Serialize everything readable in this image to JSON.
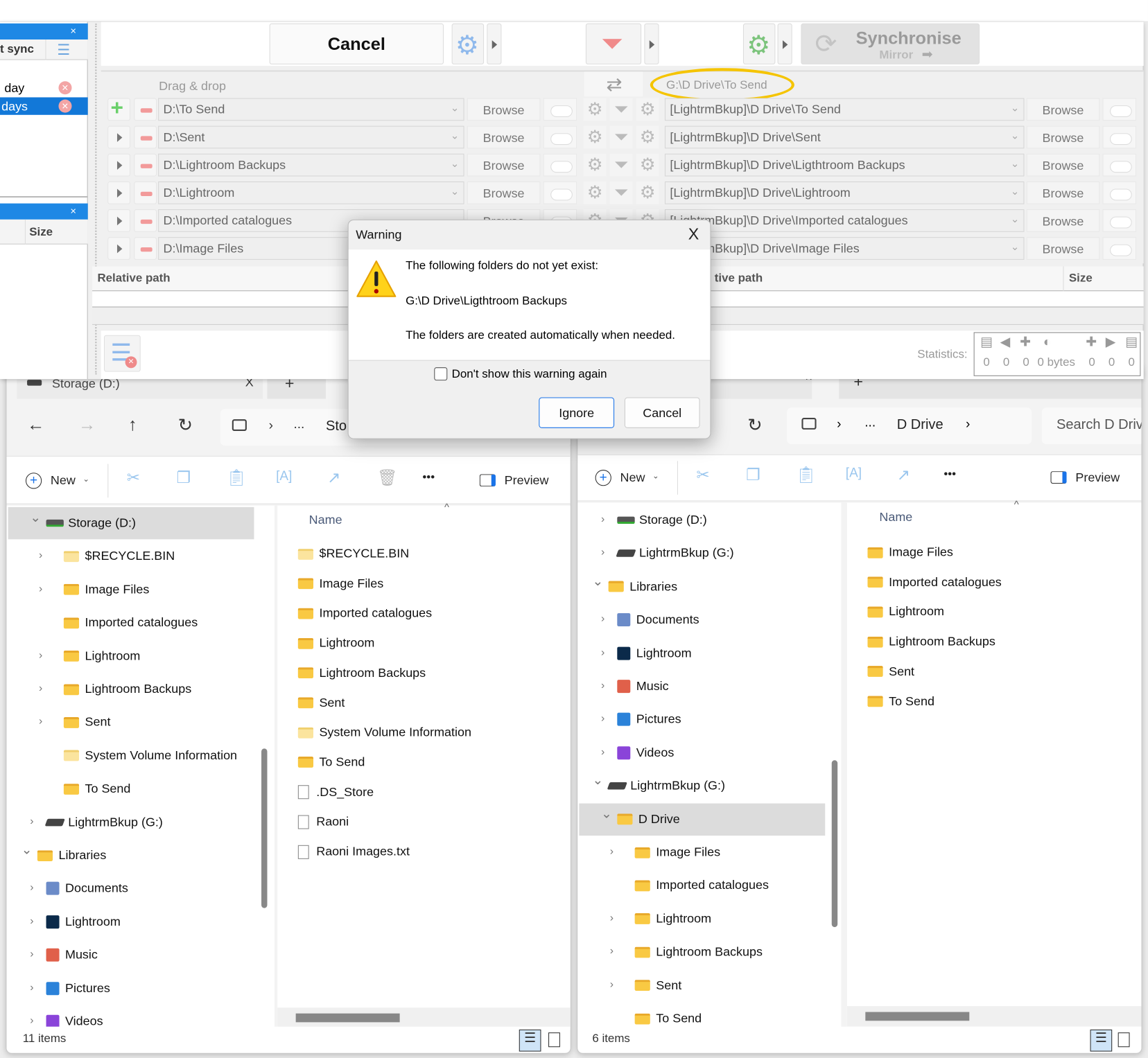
{
  "ffs": {
    "left_panel": {
      "close": "×",
      "col_header": "t sync",
      "items": [
        "day",
        "days"
      ],
      "panel2_close": "×",
      "size_header": "Size"
    },
    "toolbar": {
      "cancel": "Cancel",
      "sync_title": "Synchronise",
      "sync_mode": "Mirror"
    },
    "header": {
      "left_hint": "Drag & drop",
      "right_path": "G:\\D Drive\\To Send"
    },
    "browse_label": "Browse",
    "pairs": [
      {
        "left": "D:\\To Send",
        "right": "[LightrmBkup]\\D Drive\\To Send"
      },
      {
        "left": "D:\\Sent",
        "right": "[LightrmBkup]\\D Drive\\Sent"
      },
      {
        "left": "D:\\Lightroom Backups",
        "right": "[LightrmBkup]\\D Drive\\Ligthtroom Backups"
      },
      {
        "left": "D:\\Lightroom",
        "right": "[LightrmBkup]\\D Drive\\Lightroom"
      },
      {
        "left": "D:\\Imported catalogues",
        "right": "[LightrmBkup]\\D Drive\\Imported catalogues"
      },
      {
        "left": "D:\\Image Files",
        "right": "[LightrmBkup]\\D Drive\\Image Files"
      }
    ],
    "grid": {
      "left_col": "Relative path",
      "right_col": "tive path",
      "size_col": "Size"
    },
    "statistics": {
      "label": "Statistics:",
      "values": [
        "0",
        "0",
        "0",
        "0 bytes",
        "0",
        "0",
        "0"
      ]
    },
    "highlight_color": "#f5c400",
    "accent": "#1e88e5"
  },
  "dialog": {
    "title": "Warning",
    "close": "X",
    "line1": "The following folders do not yet exist:",
    "folder": "G:\\D Drive\\Ligthtroom Backups",
    "line2": "The folders are created automatically when needed.",
    "checkbox": "Don't show this warning again",
    "checked": false,
    "ignore": "Ignore",
    "cancel": "Cancel"
  },
  "explorer_left": {
    "tab": "Storage (D:)",
    "tab_close": "X",
    "new_tab": "+",
    "breadcrumb": [
      "...",
      "Sto"
    ],
    "new": "New",
    "preview": "Preview",
    "more": "•••",
    "tree": [
      {
        "label": "Storage (D:)",
        "icon": "drive",
        "level": 0,
        "chev": "down",
        "selected": true
      },
      {
        "label": "$RECYCLE.BIN",
        "icon": "folder-pale",
        "level": 1,
        "chev": "right"
      },
      {
        "label": "Image Files",
        "icon": "folder",
        "level": 1,
        "chev": "right"
      },
      {
        "label": "Imported catalogues",
        "icon": "folder",
        "level": 1,
        "chev": ""
      },
      {
        "label": "Lightroom",
        "icon": "folder",
        "level": 1,
        "chev": "right"
      },
      {
        "label": "Lightroom Backups",
        "icon": "folder",
        "level": 1,
        "chev": "right"
      },
      {
        "label": "Sent",
        "icon": "folder",
        "level": 1,
        "chev": "right"
      },
      {
        "label": "System Volume Information",
        "icon": "folder-pale",
        "level": 1,
        "chev": ""
      },
      {
        "label": "To Send",
        "icon": "folder",
        "level": 1,
        "chev": ""
      },
      {
        "label": "LightrmBkup (G:)",
        "icon": "usb",
        "level": 0,
        "chev": "right"
      },
      {
        "label": "Libraries",
        "icon": "folder",
        "level": -1,
        "chev": "down"
      },
      {
        "label": "Documents",
        "icon": "documents",
        "level": 0,
        "chev": "right"
      },
      {
        "label": "Lightroom",
        "icon": "lightroom",
        "level": 0,
        "chev": "right"
      },
      {
        "label": "Music",
        "icon": "music",
        "level": 0,
        "chev": "right"
      },
      {
        "label": "Pictures",
        "icon": "pictures",
        "level": 0,
        "chev": "right"
      },
      {
        "label": "Videos",
        "icon": "videos",
        "level": 0,
        "chev": "right"
      }
    ],
    "name_header": "Name",
    "files": [
      {
        "label": "$RECYCLE.BIN",
        "icon": "folder-pale"
      },
      {
        "label": "Image Files",
        "icon": "folder"
      },
      {
        "label": "Imported catalogues",
        "icon": "folder"
      },
      {
        "label": "Lightroom",
        "icon": "folder"
      },
      {
        "label": "Lightroom Backups",
        "icon": "folder"
      },
      {
        "label": "Sent",
        "icon": "folder"
      },
      {
        "label": "System Volume Information",
        "icon": "folder-pale"
      },
      {
        "label": "To Send",
        "icon": "folder"
      },
      {
        "label": ".DS_Store",
        "icon": "file"
      },
      {
        "label": "Raoni",
        "icon": "file"
      },
      {
        "label": "Raoni Images.txt",
        "icon": "file"
      }
    ],
    "status": "11 items"
  },
  "explorer_right": {
    "breadcrumb": [
      "...",
      "D Drive"
    ],
    "search_placeholder": "Search D Driv",
    "new": "New",
    "preview": "Preview",
    "more": "•••",
    "tree": [
      {
        "label": "Storage (D:)",
        "icon": "drive",
        "level": 0,
        "chev": "right"
      },
      {
        "label": "LightrmBkup (G:)",
        "icon": "usb",
        "level": 0,
        "chev": "right"
      },
      {
        "label": "Libraries",
        "icon": "folder",
        "level": -1,
        "chev": "down"
      },
      {
        "label": "Documents",
        "icon": "documents",
        "level": 0,
        "chev": "right"
      },
      {
        "label": "Lightroom",
        "icon": "lightroom",
        "level": 0,
        "chev": "right"
      },
      {
        "label": "Music",
        "icon": "music",
        "level": 0,
        "chev": "right"
      },
      {
        "label": "Pictures",
        "icon": "pictures",
        "level": 0,
        "chev": "right"
      },
      {
        "label": "Videos",
        "icon": "videos",
        "level": 0,
        "chev": "right"
      },
      {
        "label": "LightrmBkup (G:)",
        "icon": "usb",
        "level": -1,
        "chev": "down"
      },
      {
        "label": "D Drive",
        "icon": "folder",
        "level": 0,
        "chev": "down",
        "selected": true
      },
      {
        "label": "Image Files",
        "icon": "folder",
        "level": 1,
        "chev": "right"
      },
      {
        "label": "Imported catalogues",
        "icon": "folder",
        "level": 1,
        "chev": ""
      },
      {
        "label": "Lightroom",
        "icon": "folder",
        "level": 1,
        "chev": "right"
      },
      {
        "label": "Lightroom Backups",
        "icon": "folder",
        "level": 1,
        "chev": "right"
      },
      {
        "label": "Sent",
        "icon": "folder",
        "level": 1,
        "chev": "right"
      },
      {
        "label": "To Send",
        "icon": "folder",
        "level": 1,
        "chev": ""
      }
    ],
    "name_header": "Name",
    "files": [
      {
        "label": "Image Files",
        "icon": "folder"
      },
      {
        "label": "Imported catalogues",
        "icon": "folder"
      },
      {
        "label": "Lightroom",
        "icon": "folder"
      },
      {
        "label": "Lightroom Backups",
        "icon": "folder"
      },
      {
        "label": "Sent",
        "icon": "folder"
      },
      {
        "label": "To Send",
        "icon": "folder"
      }
    ],
    "status": "6 items"
  }
}
